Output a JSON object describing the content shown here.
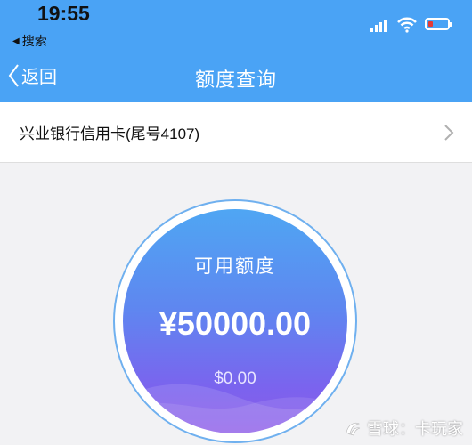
{
  "status_bar": {
    "time": "19:55",
    "back_app_label": "搜索"
  },
  "nav": {
    "back_label": "返回",
    "title": "额度查询"
  },
  "card": {
    "name": "兴业银行信用卡(尾号4107)"
  },
  "credit": {
    "label": "可用额度",
    "amount": "¥50000.00",
    "secondary_amount": "$0.00"
  },
  "watermark": {
    "text": "雪球：卡玩家"
  },
  "colors": {
    "header": "#4aa3f5",
    "circle_top": "#4fa6f3",
    "circle_bottom": "#8c5ae8",
    "battery_low": "#e53935"
  }
}
